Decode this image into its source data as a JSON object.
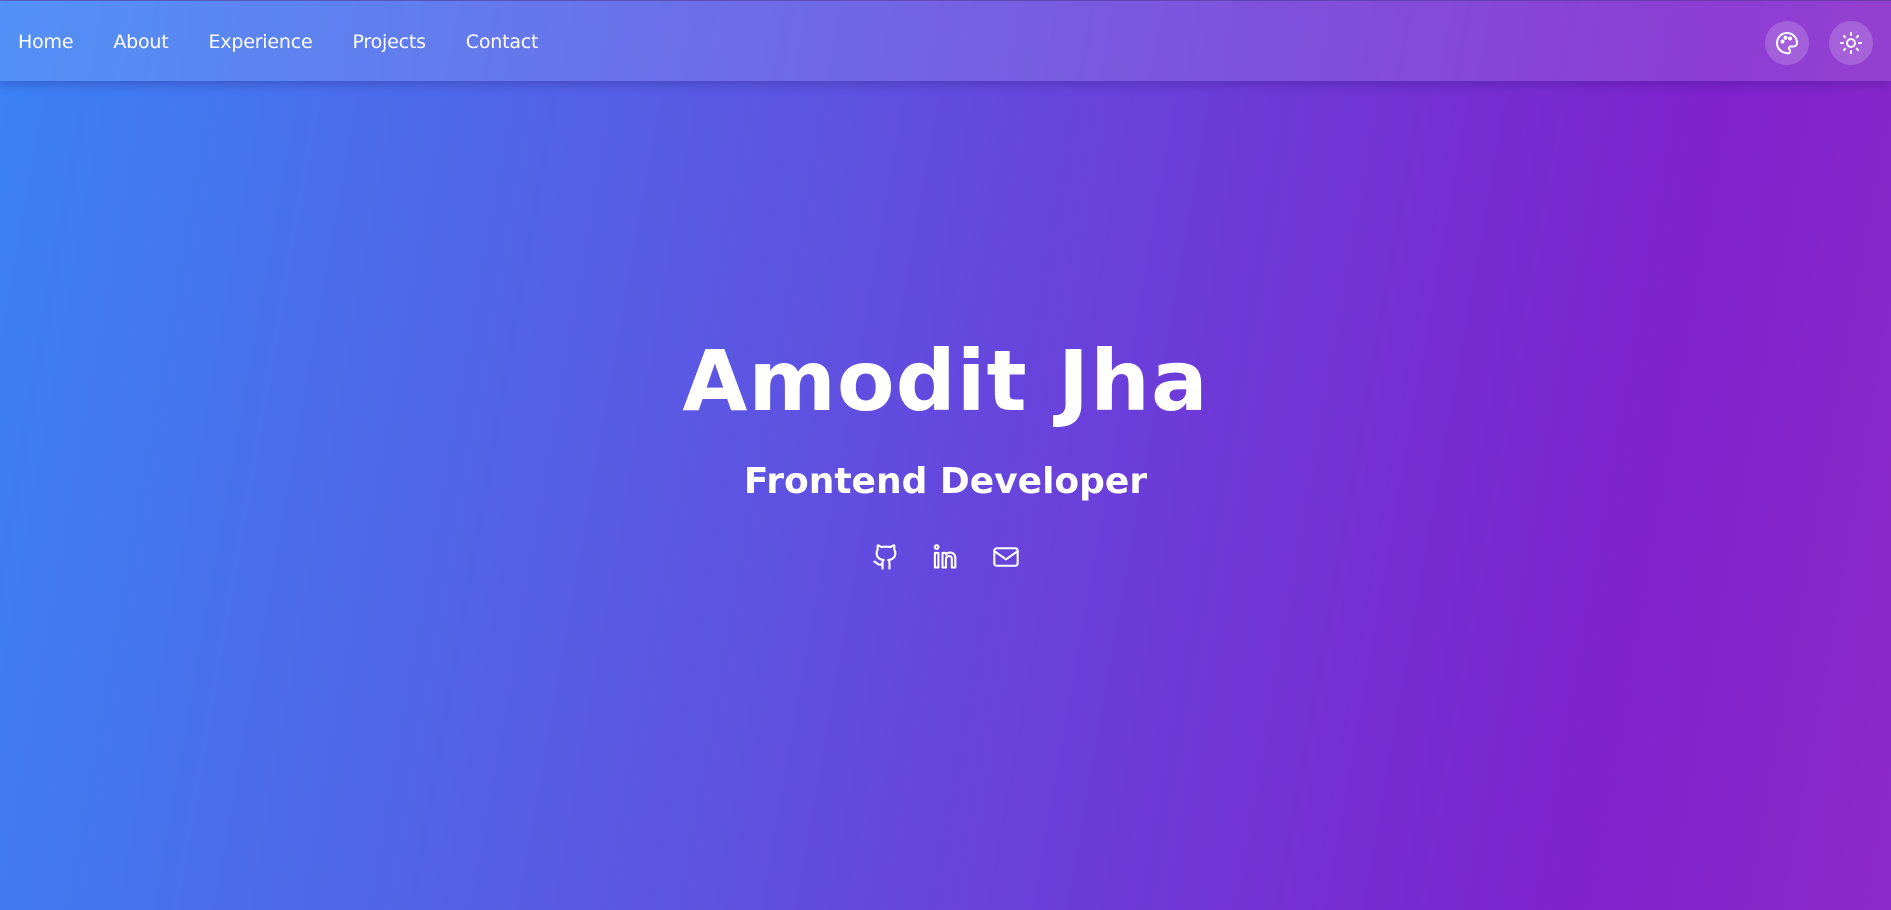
{
  "nav": {
    "links": [
      "Home",
      "About",
      "Experience",
      "Projects",
      "Contact"
    ],
    "actions": {
      "theme_palette_icon": "palette-icon",
      "theme_toggle_icon": "sun-icon"
    }
  },
  "hero": {
    "name": "Amodit Jha",
    "title": "Frontend Developer",
    "social_icons": [
      "github-icon",
      "linkedin-icon",
      "mail-icon"
    ]
  },
  "colors": {
    "gradient_start": "#3b82f6",
    "gradient_mid": "#6d3ad8",
    "gradient_end": "#7e22ce",
    "text": "#ffffff"
  }
}
